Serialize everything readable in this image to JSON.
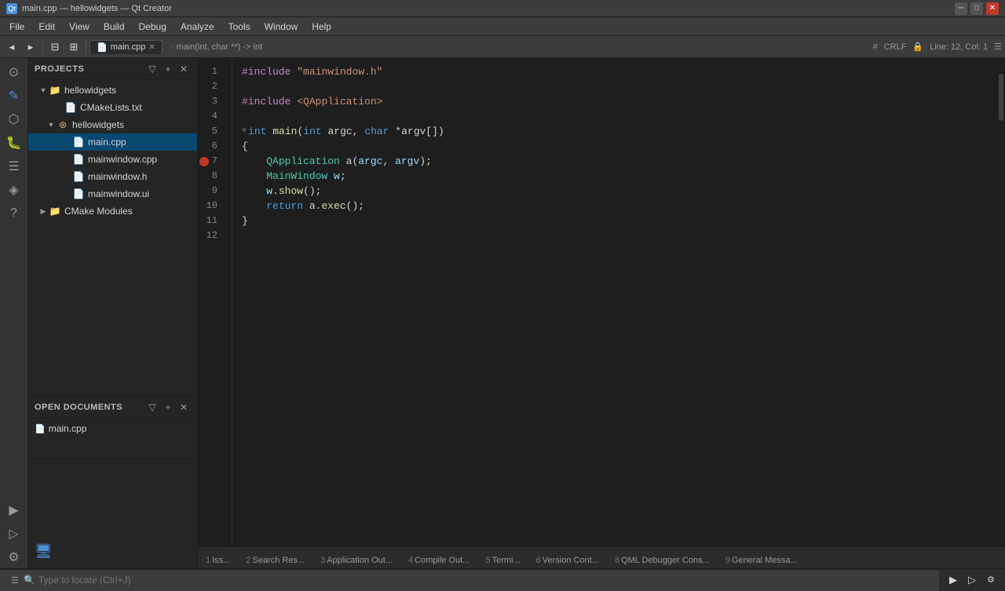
{
  "titleBar": {
    "title": "main.cpp — hellowidgets — Qt Creator",
    "appIcon": "Qt"
  },
  "menuBar": {
    "items": [
      "File",
      "Edit",
      "View",
      "Build",
      "Debug",
      "Analyze",
      "Tools",
      "Window",
      "Help"
    ]
  },
  "toolbar": {
    "tab": {
      "label": "main.cpp",
      "icon": "📄"
    },
    "breadcrumb": {
      "parts": [
        "main(int, char **) -> int"
      ]
    },
    "editorInfo": {
      "encoding": "CRLF",
      "format": "#",
      "position": "Line: 12, Col: 1"
    }
  },
  "sidebar": {
    "icons": [
      {
        "name": "welcome-icon",
        "symbol": "⊙",
        "active": false
      },
      {
        "name": "edit-icon",
        "symbol": "✎",
        "active": false
      },
      {
        "name": "design-icon",
        "symbol": "⬡",
        "active": false
      },
      {
        "name": "debug-icon",
        "symbol": "🐛",
        "active": false
      },
      {
        "name": "projects-icon",
        "symbol": "☰",
        "active": false
      },
      {
        "name": "analyze-icon",
        "symbol": "◈",
        "active": false
      },
      {
        "name": "help-icon",
        "symbol": "?",
        "active": false
      }
    ],
    "bottomIcons": [
      {
        "name": "build-icon",
        "symbol": "▶"
      },
      {
        "name": "debug-run-icon",
        "symbol": "▷"
      },
      {
        "name": "kit-icon",
        "symbol": "⚙"
      }
    ]
  },
  "projectsPanel": {
    "title": "Projects",
    "root": {
      "name": "hellowidgets",
      "type": "folder",
      "expanded": true,
      "children": [
        {
          "name": "CMakeLists.txt",
          "type": "txt"
        },
        {
          "name": "hellowidgets",
          "type": "folder",
          "expanded": true,
          "children": [
            {
              "name": "main.cpp",
              "type": "cpp",
              "selected": true
            },
            {
              "name": "mainwindow.cpp",
              "type": "cpp"
            },
            {
              "name": "mainwindow.h",
              "type": "h"
            },
            {
              "name": "mainwindow.ui",
              "type": "ui"
            }
          ]
        },
        {
          "name": "CMake Modules",
          "type": "cmake",
          "expanded": false
        }
      ]
    }
  },
  "openDocuments": {
    "title": "Open Documents",
    "items": [
      {
        "name": "main.cpp",
        "icon": "📄"
      }
    ]
  },
  "codeEditor": {
    "filename": "main.cpp",
    "lines": [
      {
        "num": 1,
        "tokens": [
          {
            "t": "#include",
            "c": "inc"
          },
          {
            "t": " \"mainwindow.h\"",
            "c": "str"
          }
        ]
      },
      {
        "num": 2,
        "tokens": []
      },
      {
        "num": 3,
        "tokens": [
          {
            "t": "#include",
            "c": "inc"
          },
          {
            "t": " <QApplication>",
            "c": "str"
          }
        ]
      },
      {
        "num": 4,
        "tokens": []
      },
      {
        "num": 5,
        "fold": true,
        "tokens": [
          {
            "t": "int",
            "c": "kw"
          },
          {
            "t": " ",
            "c": "plain"
          },
          {
            "t": "main",
            "c": "fn"
          },
          {
            "t": "(",
            "c": "plain"
          },
          {
            "t": "int",
            "c": "kw"
          },
          {
            "t": " argc, ",
            "c": "plain"
          },
          {
            "t": "char",
            "c": "kw"
          },
          {
            "t": " *argv[])",
            "c": "plain"
          }
        ]
      },
      {
        "num": 6,
        "tokens": [
          {
            "t": "{",
            "c": "plain"
          }
        ]
      },
      {
        "num": 7,
        "breakpoint": true,
        "tokens": [
          {
            "t": "    ",
            "c": "plain"
          },
          {
            "t": "QApplication",
            "c": "cls"
          },
          {
            "t": " a(",
            "c": "plain"
          },
          {
            "t": "argc",
            "c": "var"
          },
          {
            "t": ", ",
            "c": "plain"
          },
          {
            "t": "argv",
            "c": "var"
          },
          {
            "t": ");",
            "c": "plain"
          }
        ]
      },
      {
        "num": 8,
        "tokens": [
          {
            "t": "    ",
            "c": "plain"
          },
          {
            "t": "MainWindow",
            "c": "cls"
          },
          {
            "t": " ",
            "c": "plain"
          },
          {
            "t": "w",
            "c": "var"
          },
          {
            "t": ";",
            "c": "plain"
          }
        ]
      },
      {
        "num": 9,
        "tokens": [
          {
            "t": "    ",
            "c": "plain"
          },
          {
            "t": "w",
            "c": "var"
          },
          {
            "t": ".",
            "c": "plain"
          },
          {
            "t": "show",
            "c": "fn"
          },
          {
            "t": "();",
            "c": "plain"
          }
        ]
      },
      {
        "num": 10,
        "tokens": [
          {
            "t": "    ",
            "c": "plain"
          },
          {
            "t": "return",
            "c": "kw"
          },
          {
            "t": " a.",
            "c": "plain"
          },
          {
            "t": "exec",
            "c": "fn"
          },
          {
            "t": "();",
            "c": "plain"
          }
        ]
      },
      {
        "num": 11,
        "tokens": [
          {
            "t": "}",
            "c": "plain"
          }
        ]
      },
      {
        "num": 12,
        "tokens": []
      }
    ]
  },
  "bottomTabs": [
    {
      "num": "1",
      "label": "Iss..."
    },
    {
      "num": "2",
      "label": "Search Res..."
    },
    {
      "num": "3",
      "label": "Application Out..."
    },
    {
      "num": "4",
      "label": "Compile Out..."
    },
    {
      "num": "5",
      "label": "Termi..."
    },
    {
      "num": "6",
      "label": "Version Cont..."
    },
    {
      "num": "8",
      "label": "QML Debugger Cons..."
    },
    {
      "num": "9",
      "label": "General Messa..."
    }
  ],
  "statusBar": {
    "locatePlaceholder": "Type to locate (Ctrl+J)",
    "buildStatus": ""
  }
}
